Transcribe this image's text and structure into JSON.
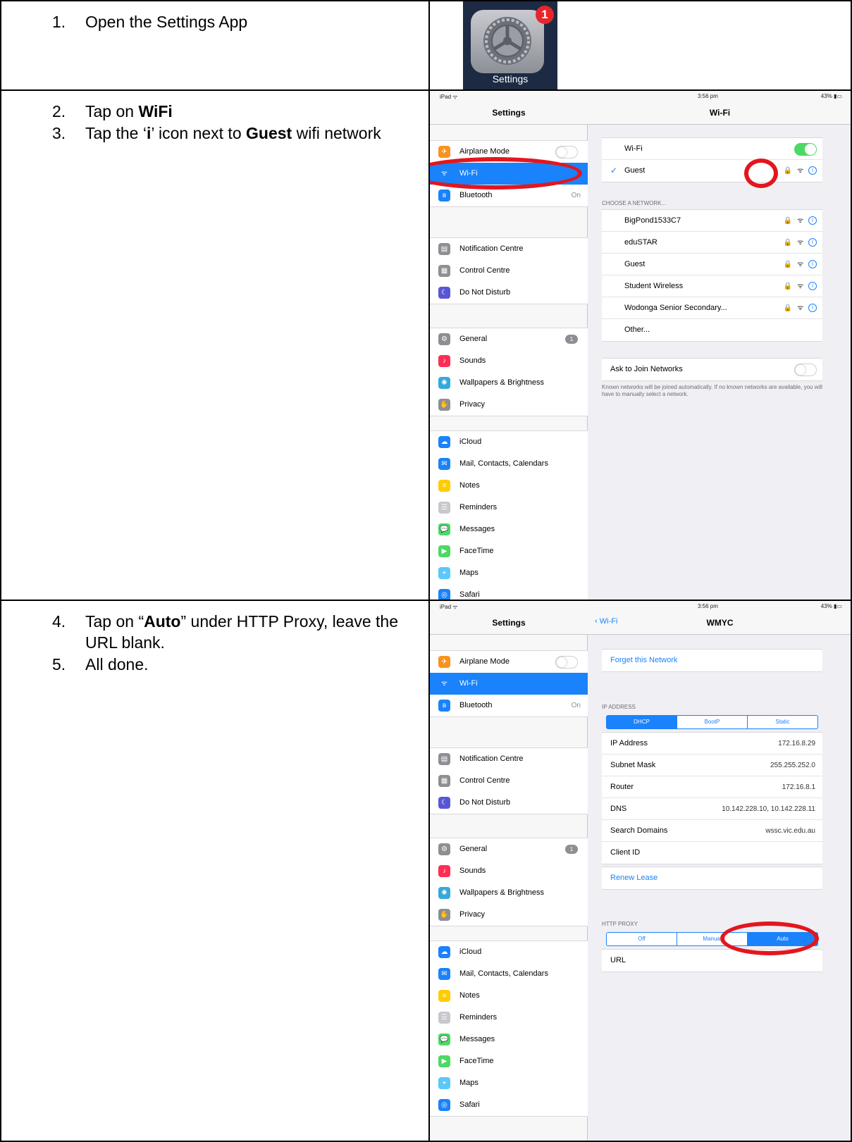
{
  "rows": [
    {
      "steps": [
        {
          "num": "1.",
          "parts": [
            {
              "t": "Open the Settings App",
              "b": false
            }
          ]
        }
      ]
    },
    {
      "steps": [
        {
          "num": "2.",
          "parts": [
            {
              "t": "Tap on ",
              "b": false
            },
            {
              "t": "WiFi",
              "b": true
            }
          ]
        },
        {
          "num": "3.",
          "parts": [
            {
              "t": "Tap the ‘",
              "b": false
            },
            {
              "t": "i",
              "b": true
            },
            {
              "t": "’ icon next to ",
              "b": false
            },
            {
              "t": "Guest",
              "b": true
            },
            {
              "t": " wifi network",
              "b": false
            }
          ]
        }
      ]
    },
    {
      "steps": [
        {
          "num": "4.",
          "parts": [
            {
              "t": "Tap on “",
              "b": false
            },
            {
              "t": "Auto",
              "b": true
            },
            {
              "t": "” under HTTP Proxy, leave the URL blank.",
              "b": false
            }
          ]
        },
        {
          "num": "5.",
          "parts": [
            {
              "t": "All done.",
              "b": false
            }
          ]
        }
      ]
    }
  ],
  "app_icon": {
    "label": "Settings",
    "badge": "1"
  },
  "status": {
    "device": "iPad ᯤ",
    "time": "3:56 pm",
    "battery": "43% ▮▭"
  },
  "sidebar": {
    "title": "Settings",
    "groups": [
      [
        {
          "label": "Airplane Mode",
          "icon_color": "#f7931e",
          "icon": "✈",
          "extra": "toggle"
        },
        {
          "label": "Wi-Fi",
          "icon_color": "#1a82fb",
          "icon": "ᯤ",
          "selected": true
        },
        {
          "label": "Bluetooth",
          "icon_color": "#1a82fb",
          "icon": "ʙ",
          "right": "On"
        }
      ],
      [
        {
          "label": "Notification Centre",
          "icon_color": "#8e8e93",
          "icon": "▤"
        },
        {
          "label": "Control Centre",
          "icon_color": "#8e8e93",
          "icon": "▦"
        },
        {
          "label": "Do Not Disturb",
          "icon_color": "#5856d6",
          "icon": "☾"
        }
      ],
      [
        {
          "label": "General",
          "icon_color": "#8e8e93",
          "icon": "⚙",
          "badge": "1"
        },
        {
          "label": "Sounds",
          "icon_color": "#ff2d55",
          "icon": "♪"
        },
        {
          "label": "Wallpapers & Brightness",
          "icon_color": "#34aadc",
          "icon": "✺"
        },
        {
          "label": "Privacy",
          "icon_color": "#8e8e93",
          "icon": "✋"
        }
      ],
      [
        {
          "label": "iCloud",
          "icon_color": "#1a82fb",
          "icon": "☁"
        },
        {
          "label": "Mail, Contacts, Calendars",
          "icon_color": "#1a82fb",
          "icon": "✉"
        },
        {
          "label": "Notes",
          "icon_color": "#ffcc00",
          "icon": "≡"
        },
        {
          "label": "Reminders",
          "icon_color": "#c7c7cc",
          "icon": "☰"
        },
        {
          "label": "Messages",
          "icon_color": "#4cd964",
          "icon": "💬"
        },
        {
          "label": "FaceTime",
          "icon_color": "#4cd964",
          "icon": "▶"
        },
        {
          "label": "Maps",
          "icon_color": "#5ac8fa",
          "icon": "⌖"
        },
        {
          "label": "Safari",
          "icon_color": "#1a82fb",
          "icon": "◎"
        }
      ]
    ]
  },
  "wifi_screen": {
    "title": "Wi-Fi",
    "wifi_label": "Wi-Fi",
    "connected": "Guest",
    "choose_label": "CHOOSE A NETWORK...",
    "networks": [
      "BigPond1533C7",
      "eduSTAR",
      "Guest",
      "Student Wireless",
      "Wodonga Senior Secondary..."
    ],
    "other": "Other...",
    "ask_label": "Ask to Join Networks",
    "ask_note": "Known networks will be joined automatically. If no known networks are available, you will have to manually select a network.",
    "lock_wifi_glyphs": "🔒 ᯤ",
    "info_glyph": "i"
  },
  "detail_screen": {
    "back": "Wi-Fi",
    "title": "WMYC",
    "forget": "Forget this Network",
    "ip_label": "IP ADDRESS",
    "ip_modes": [
      "DHCP",
      "BootP",
      "Static"
    ],
    "ip_rows": [
      {
        "k": "IP Address",
        "v": "172.16.8.29"
      },
      {
        "k": "Subnet Mask",
        "v": "255.255.252.0"
      },
      {
        "k": "Router",
        "v": "172.16.8.1"
      },
      {
        "k": "DNS",
        "v": "10.142.228.10, 10.142.228.11"
      },
      {
        "k": "Search Domains",
        "v": "wssc.vic.edu.au"
      },
      {
        "k": "Client ID",
        "v": ""
      }
    ],
    "renew": "Renew Lease",
    "proxy_label": "HTTP PROXY",
    "proxy_modes": [
      "Off",
      "Manual",
      "Auto"
    ],
    "url_label": "URL"
  },
  "colors": {
    "accent": "#1a82fb",
    "highlight": "#e3161e",
    "toggle_on": "#4cd964"
  }
}
